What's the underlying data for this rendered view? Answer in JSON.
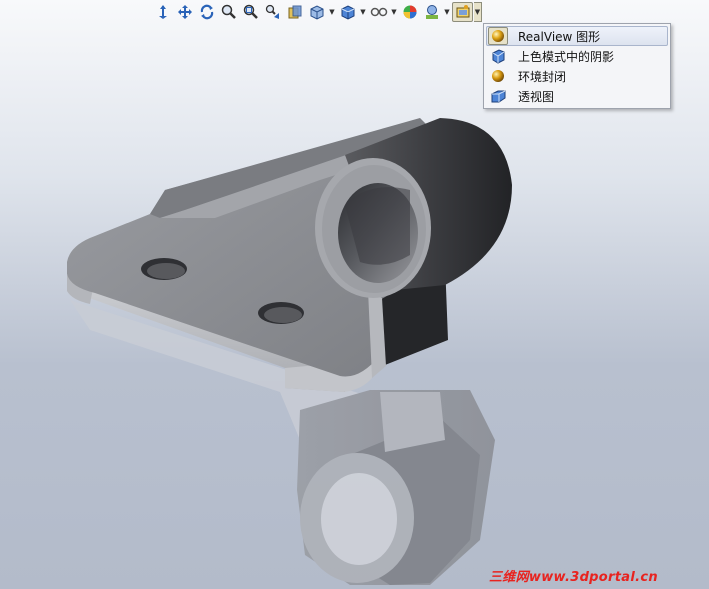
{
  "toolbar": {
    "buttons": [
      {
        "icon": "view-orientation-icon"
      },
      {
        "icon": "pan-icon"
      },
      {
        "icon": "rotate-icon"
      },
      {
        "icon": "zoom-to-fit-icon"
      },
      {
        "icon": "zoom-to-area-icon"
      },
      {
        "icon": "previous-view-icon"
      },
      {
        "icon": "section-view-icon"
      },
      {
        "icon": "view-orientation-cube-icon",
        "dropdown": true
      },
      {
        "icon": "display-style-icon",
        "dropdown": true
      },
      {
        "icon": "hide-show-items-icon",
        "dropdown": true
      },
      {
        "icon": "edit-appearance-icon"
      },
      {
        "icon": "apply-scene-icon",
        "dropdown": true
      },
      {
        "icon": "view-settings-icon",
        "dropdown": true,
        "active": true
      }
    ]
  },
  "view_settings_menu": {
    "items": [
      {
        "label": "RealView 图形",
        "icon": "realview-sphere-icon",
        "checked": true
      },
      {
        "label": "上色模式中的阴影",
        "icon": "shadows-cube-icon",
        "checked": false
      },
      {
        "label": "环境封闭",
        "icon": "ambient-occlusion-sphere-icon",
        "checked": false
      },
      {
        "label": "透视图",
        "icon": "perspective-box-icon",
        "checked": false
      }
    ]
  },
  "watermark": "三维网www.3dportal.cn",
  "colors": {
    "background_top": "#f8f9fb",
    "background_bottom": "#b3bbca",
    "menu_bg": "#f4f5f8",
    "menu_highlight": "#dde3ef",
    "watermark": "#e8231f"
  }
}
